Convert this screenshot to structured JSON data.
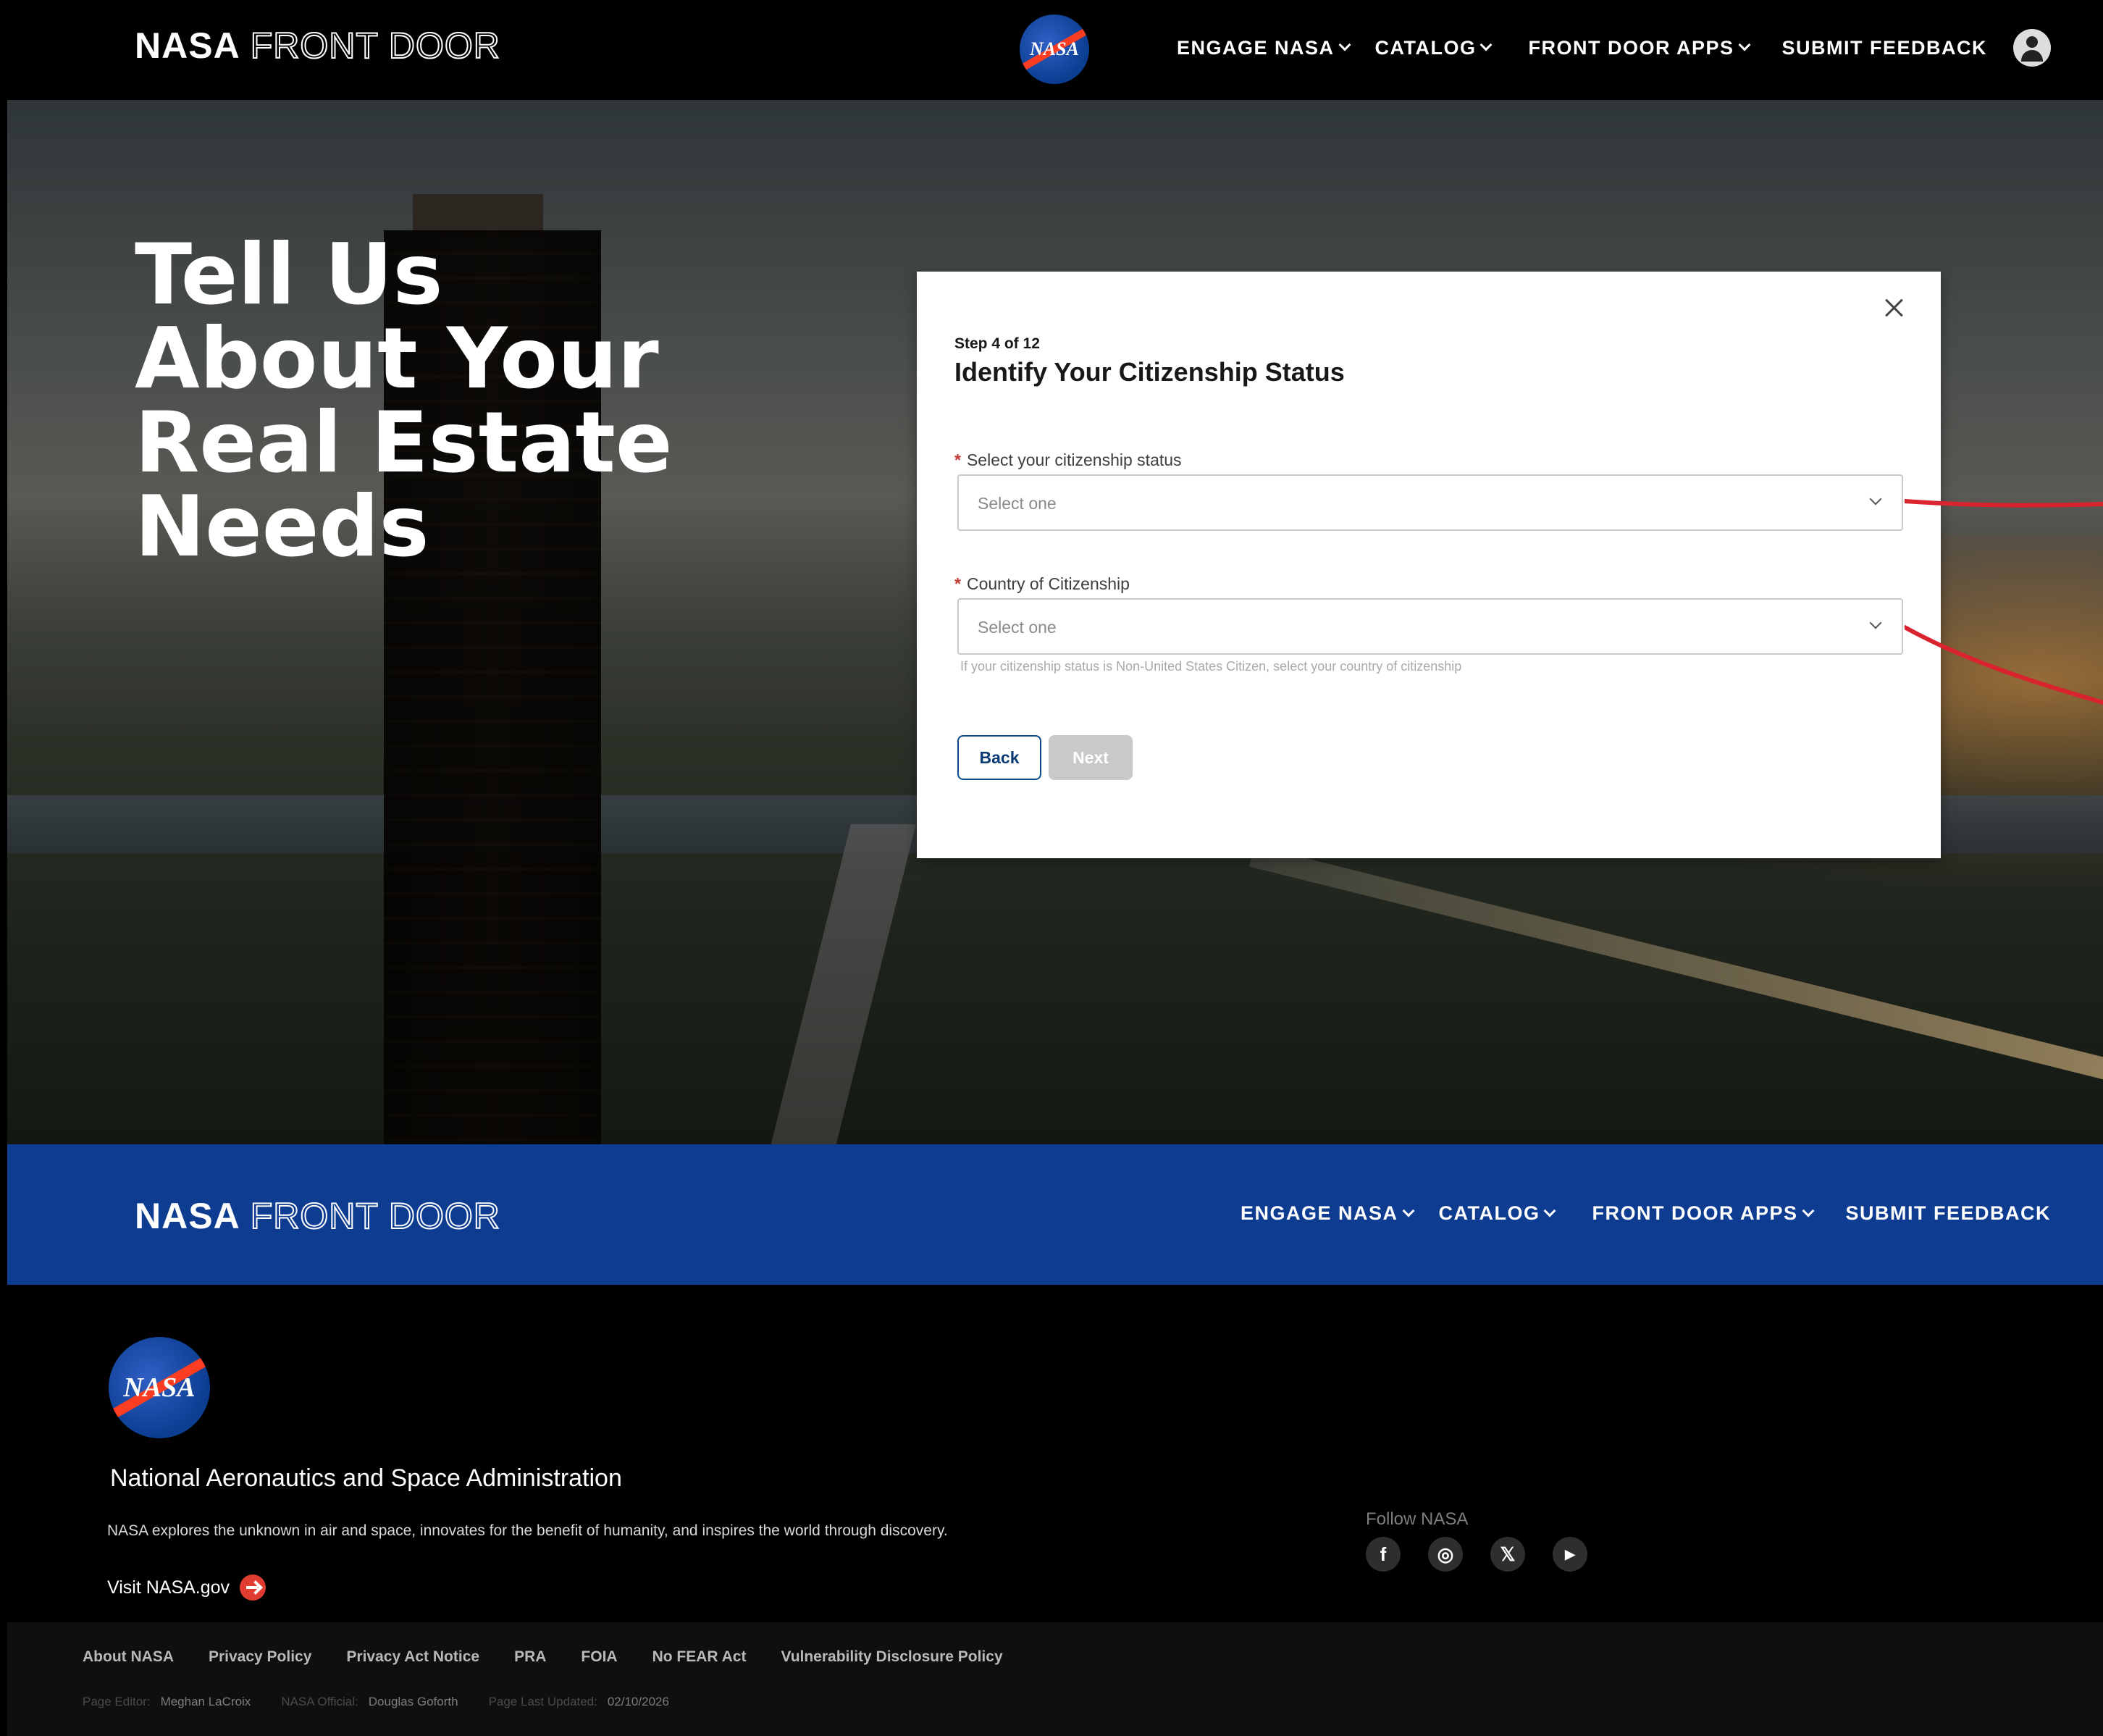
{
  "header": {
    "brand_bold": "NASA",
    "brand_outline": "FRONT DOOR",
    "logo_text": "NASA",
    "nav": [
      "ENGAGE NASA",
      "CATALOG",
      "FRONT DOOR APPS",
      "SUBMIT FEEDBACK"
    ]
  },
  "hero": {
    "title_lines": [
      "Tell Us",
      "About Your",
      "Real Estate",
      "Needs"
    ]
  },
  "modal": {
    "step": "Step 4 of 12",
    "title": "Identify Your Citizenship Status",
    "fields": [
      {
        "label": "Select your citizenship status",
        "required_mark": "*",
        "value": "Select one"
      },
      {
        "label": "Country of Citizenship",
        "required_mark": "*",
        "value": "Select one"
      }
    ],
    "help_text": "If your citizenship status is Non-United States Citizen, select your country of citizenship",
    "back_label": "Back",
    "next_label": "Next"
  },
  "footer_nav": {
    "brand_bold": "NASA",
    "brand_outline": "FRONT DOOR",
    "nav": [
      "ENGAGE NASA",
      "CATALOG",
      "FRONT DOOR APPS",
      "SUBMIT FEEDBACK"
    ]
  },
  "footer": {
    "logo_text": "NASA",
    "org_name": "National Aeronautics and Space Administration",
    "description": "NASA explores the unknown in air and space, innovates for the benefit of humanity, and inspires the world through discovery.",
    "visit_label": "Visit NASA.gov",
    "follow_label": "Follow NASA",
    "socials": [
      "f",
      "◎",
      "𝕏",
      "▶"
    ],
    "legal_links": [
      "About NASA",
      "Privacy Policy",
      "Privacy Act Notice",
      "PRA",
      "FOIA",
      "No FEAR Act",
      "Vulnerability Disclosure Policy"
    ],
    "meta": [
      {
        "key": "Page Editor:",
        "value": "Meghan LaCroix"
      },
      {
        "key": "NASA Official:",
        "value": "Douglas Goforth"
      },
      {
        "key": "Page Last Updated:",
        "value": "02/10/2026"
      }
    ]
  },
  "colors": {
    "footer_blue": "#0e3c91",
    "required_red": "#c23934",
    "back_button_border": "#0b4a8b",
    "annotation_red": "#d9232e"
  }
}
